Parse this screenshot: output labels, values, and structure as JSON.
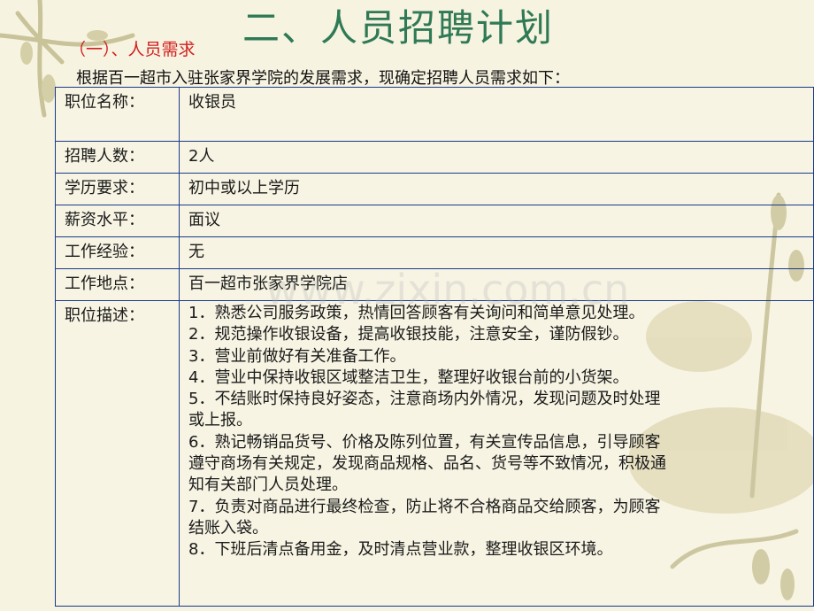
{
  "title": "二、人员招聘计划",
  "subtitle": "（一）、人员需求",
  "intro": "根据百一超市入驻张家界学院的发展需求，现确定招聘人员需求如下：",
  "watermark": "www.zixin.com.cn",
  "rows": [
    {
      "label": "职位名称：",
      "value": "收银员"
    },
    {
      "label": "招聘人数：",
      "value": "2人"
    },
    {
      "label": "学历要求：",
      "value": "初中或以上学历"
    },
    {
      "label": "薪资水平：",
      "value": "面议"
    },
    {
      "label": "工作经验：",
      "value": "无"
    },
    {
      "label": "工作地点：",
      "value": "百一超市张家界学院店"
    },
    {
      "label": "职位描述：",
      "value": ""
    }
  ],
  "description_lines": [
    "1．熟悉公司服务政策，热情回答顾客有关询问和简单意见处理。",
    "2．规范操作收银设备，提高收银技能，注意安全，谨防假钞。",
    "3．营业前做好有关准备工作。",
    "4．营业中保持收银区域整洁卫生，整理好收银台前的小货架。",
    "5．不结账时保持良好姿态，注意商场内外情况，发现问题及时处理",
    "或上报。",
    "6．熟记畅销品货号、价格及陈列位置，有关宣传品信息，引导顾客",
    "遵守商场有关规定，发现商品规格、品名、货号等不致情况，积极通",
    "知有关部门人员处理。",
    "7．负责对商品进行最终检查，防止将不合格商品交给顾客，为顾客",
    "结账入袋。",
    "8．下班后清点备用金，及时清点营业款，整理收银区环境。"
  ]
}
